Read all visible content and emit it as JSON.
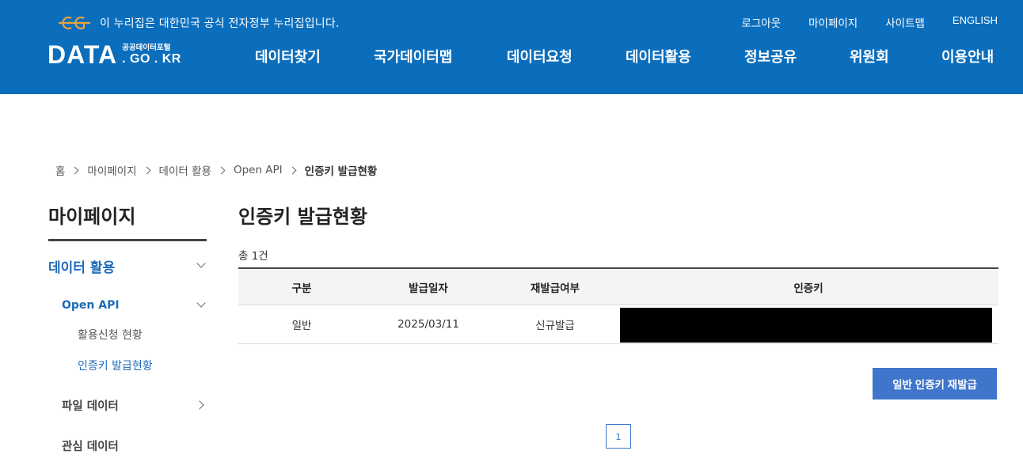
{
  "gov_banner": {
    "text": "이 누리집은 대한민국 공식 전자정부 누리집입니다."
  },
  "util_nav": [
    "로그아웃",
    "마이페이지",
    "사이트맵",
    "ENGLISH"
  ],
  "brand": {
    "main": "DATA",
    "small": "공공데이터포털",
    "domain": ". GO . KR"
  },
  "gnb": [
    "데이터찾기",
    "국가데이터맵",
    "데이터요청",
    "데이터활용",
    "정보공유",
    "위원회",
    "이용안내"
  ],
  "breadcrumb": [
    "홈",
    "마이페이지",
    "데이터 활용",
    "Open API",
    "인증키 발급현황"
  ],
  "sidebar": {
    "title": "마이페이지",
    "section": "데이터 활용",
    "sub": "Open API",
    "items": [
      "활용신청 현황",
      "인증키 발급현황"
    ],
    "others": [
      "파일 데이터",
      "관심 데이터"
    ]
  },
  "main": {
    "title": "인증키 발급현황",
    "total": "총 1건",
    "columns": [
      "구분",
      "발급일자",
      "재발급여부",
      "인증키"
    ],
    "rows": [
      {
        "type": "일반",
        "date": "2025/03/11",
        "reissue": "신규발급",
        "key": ""
      }
    ],
    "reissue_button": "일반 인증키 재발급",
    "page": "1"
  },
  "colors": {
    "header_bg": "#0b6ebd",
    "accent": "#3f76cc",
    "side_active": "#1e6bb8"
  }
}
